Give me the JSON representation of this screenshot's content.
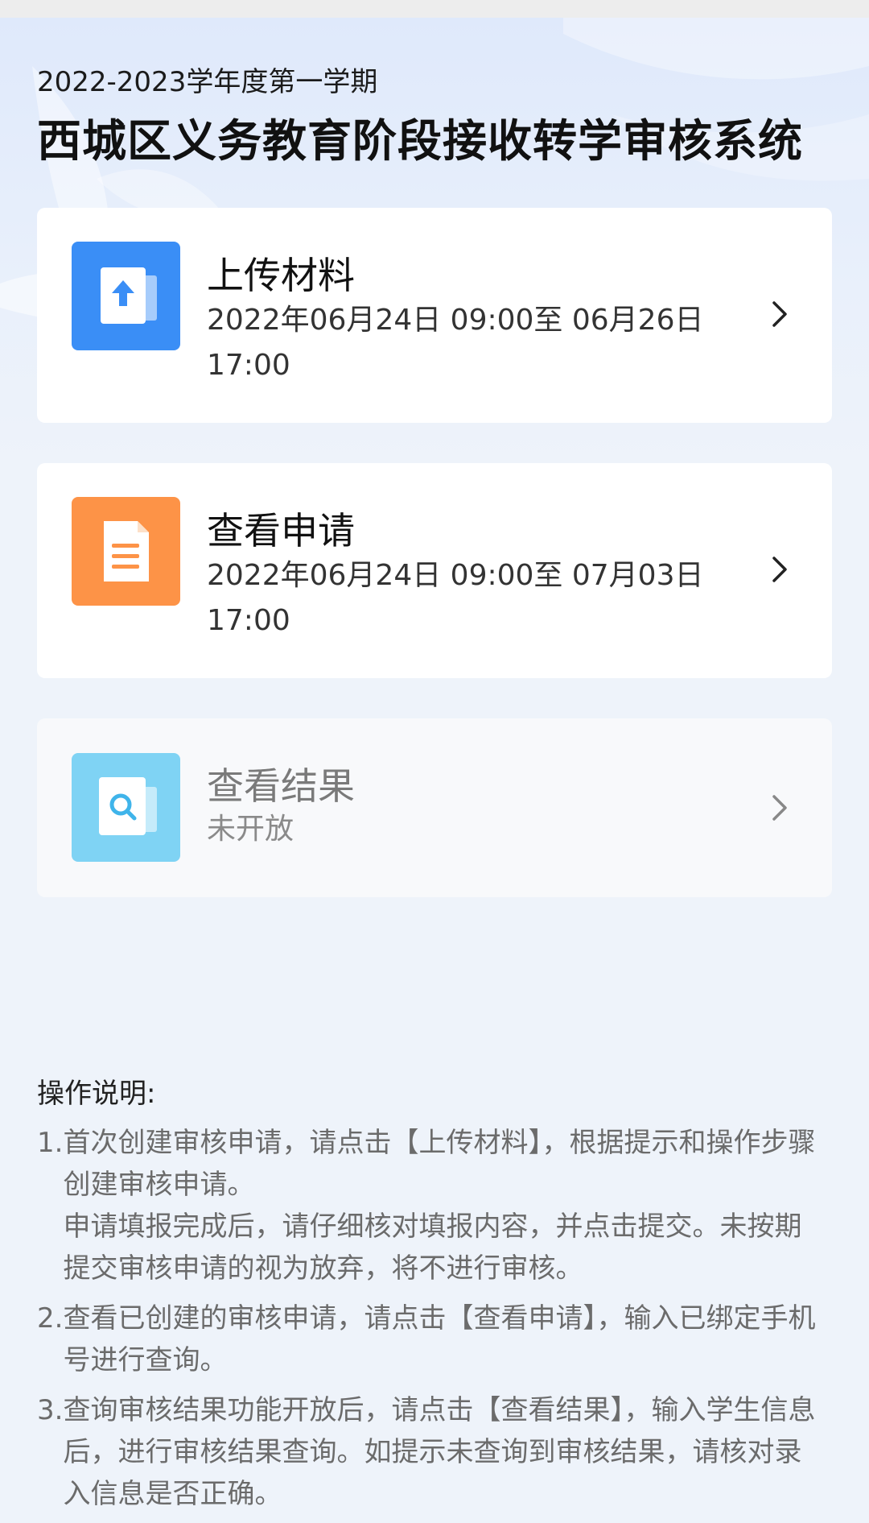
{
  "header": {
    "term": "2022-2023学年度第一学期",
    "title": "西城区义务教育阶段接收转学审核系统"
  },
  "cards": [
    {
      "title": "上传材料",
      "subtitle": "2022年06月24日 09:00至 06月26日 17:00",
      "icon": "upload-document-icon",
      "color": "#3a8ef6",
      "enabled": true
    },
    {
      "title": "查看申请",
      "subtitle": "2022年06月24日 09:00至 07月03日 17:00",
      "icon": "document-lines-icon",
      "color": "#fd9347",
      "enabled": true
    },
    {
      "title": "查看结果",
      "subtitle": "未开放",
      "icon": "search-document-icon",
      "color": "#7fd3f4",
      "enabled": false
    }
  ],
  "instructions": {
    "heading": "操作说明:",
    "items": [
      {
        "num": "1.",
        "lines": [
          "首次创建审核申请，请点击【上传材料】，根据提示和操作步骤创建审核申请。",
          "申请填报完成后，请仔细核对填报内容，并点击提交。未按期提交审核申请的视为放弃，将不进行审核。"
        ]
      },
      {
        "num": "2.",
        "lines": [
          "查看已创建的审核申请，请点击【查看申请】，输入已绑定手机号进行查询。"
        ]
      },
      {
        "num": "3.",
        "lines": [
          "查询审核结果功能开放后，请点击【查看结果】，输入学生信息后，进行审核结果查询。如提示未查询到审核结果，请核对录入信息是否正确。"
        ]
      }
    ]
  }
}
